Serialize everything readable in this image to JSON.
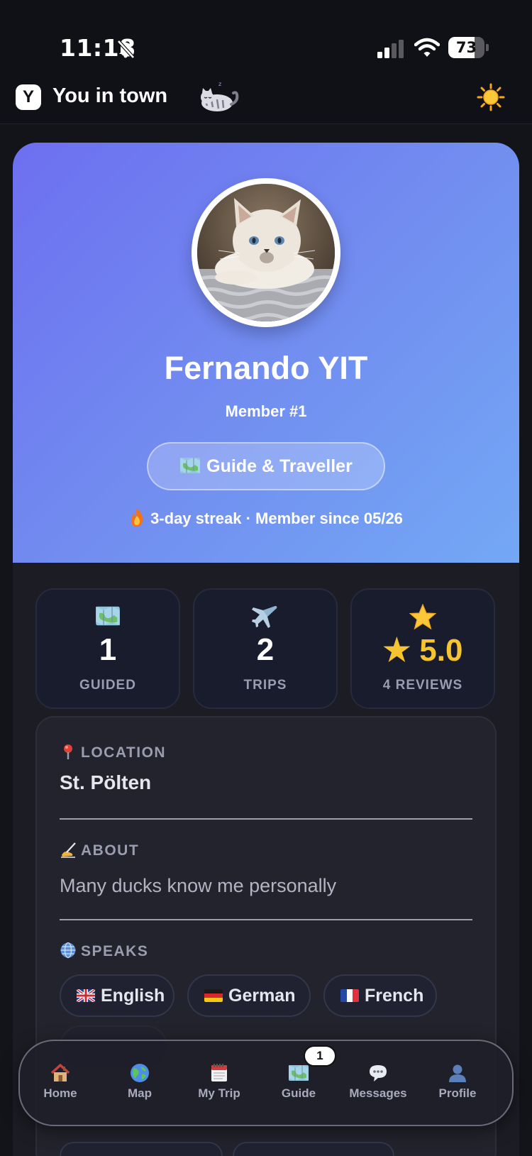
{
  "status_bar": {
    "time": "11:18",
    "battery_level": 73,
    "battery_text": "73",
    "silent_mode": true
  },
  "header": {
    "logo_letter": "Y",
    "title": "You in town",
    "mascot_icon": "sleeping-cat-icon",
    "theme_icon": "sun-icon"
  },
  "profile": {
    "name": "Fernando YIT",
    "member_number": "Member #1",
    "role": "Guide & Traveller",
    "role_icon": "map-icon",
    "streak_line": "3-day streak · Member since 05/26",
    "streak_icon": "flame-icon",
    "avatar_description_icon": "cat-avatar"
  },
  "stats": [
    {
      "icon": "map-icon",
      "value": "1",
      "label": "GUIDED"
    },
    {
      "icon": "airplane-icon",
      "value": "2",
      "label": "TRIPS"
    },
    {
      "icon": "star-icon",
      "value": "★ 5.0",
      "label": "4 REVIEWS"
    }
  ],
  "info": {
    "location_label": "LOCATION",
    "location_value": "St. Pölten",
    "about_label": "ABOUT",
    "about_value": "Many ducks know me personally",
    "speaks_label": "SPEAKS",
    "languages": [
      {
        "name": "English",
        "flag": "uk-flag-icon"
      },
      {
        "name": "German",
        "flag": "germany-flag-icon"
      },
      {
        "name": "French",
        "flag": "france-flag-icon"
      }
    ]
  },
  "nav": {
    "items": [
      {
        "label": "Home",
        "icon": "house-icon"
      },
      {
        "label": "Map",
        "icon": "globe-icon"
      },
      {
        "label": "My Trip",
        "icon": "calendar-icon"
      },
      {
        "label": "Guide",
        "icon": "map-icon"
      },
      {
        "label": "Messages",
        "icon": "speech-bubble-icon"
      },
      {
        "label": "Profile",
        "icon": "user-icon"
      }
    ],
    "guide_badge": "1",
    "active": "Profile"
  },
  "colors": {
    "hero_gradient_start": "#6d6ff0",
    "hero_gradient_end": "#73a8f5",
    "rating_gold": "#f6c431",
    "background": "#13131a"
  }
}
